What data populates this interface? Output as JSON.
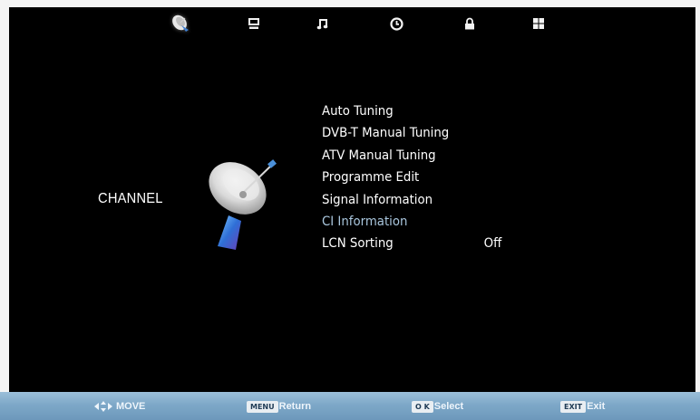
{
  "tabs": [
    {
      "icon": "satellite-dish-icon",
      "active": true
    },
    {
      "icon": "monitor-icon",
      "active": false
    },
    {
      "icon": "music-note-icon",
      "active": false
    },
    {
      "icon": "clock-icon",
      "active": false
    },
    {
      "icon": "lock-icon",
      "active": false
    },
    {
      "icon": "grid-icon",
      "active": false
    }
  ],
  "section_title": "CHANNEL",
  "menu": {
    "items": [
      {
        "label": "Auto Tuning",
        "value": "",
        "enabled": true
      },
      {
        "label": "DVB-T Manual Tuning",
        "value": "",
        "enabled": true
      },
      {
        "label": "ATV Manual Tuning",
        "value": "",
        "enabled": true
      },
      {
        "label": "Programme Edit",
        "value": "",
        "enabled": true
      },
      {
        "label": "Signal Information",
        "value": "",
        "enabled": true
      },
      {
        "label": "CI Information",
        "value": "",
        "enabled": false
      },
      {
        "label": "LCN Sorting",
        "value": "Off",
        "enabled": true
      }
    ]
  },
  "help_bar": {
    "move_label": "MOVE",
    "return_key": "MENU",
    "return_label": "Return",
    "select_key": "O K",
    "select_label": "Select",
    "exit_key": "EXIT",
    "exit_label": "Exit"
  },
  "colors": {
    "background": "#000000",
    "text": "#ffffff",
    "disabled_text": "#a9c6dd",
    "help_bar": "#7ea8c8"
  }
}
